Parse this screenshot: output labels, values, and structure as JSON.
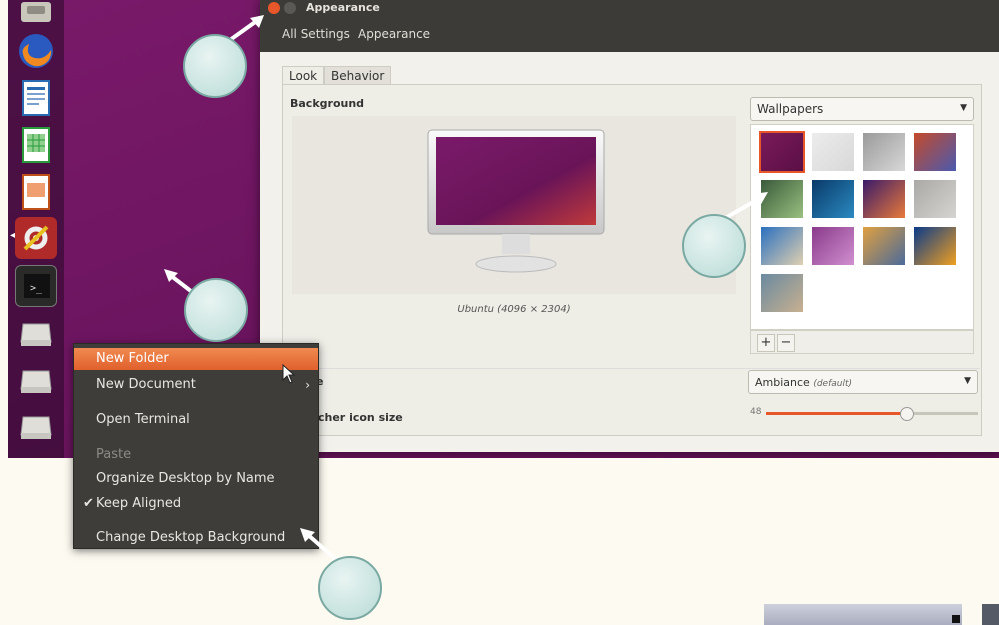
{
  "window": {
    "title": "Appearance",
    "breadcrumbs": [
      "All Settings",
      "Appearance"
    ]
  },
  "tabs": [
    "Look",
    "Behavior"
  ],
  "background": {
    "label": "Background",
    "preview_caption": "Ubuntu (4096 × 2304)",
    "source_select": "Wallpapers",
    "wallpapers": [
      {
        "name": "wallpaper-ubuntu-default",
        "colors": [
          "#7a1a5a",
          "#5a0f45"
        ],
        "selected": true
      },
      {
        "name": "wallpaper-light-grey",
        "colors": [
          "#ececec",
          "#d8d8d8"
        ]
      },
      {
        "name": "wallpaper-grey-stone",
        "colors": [
          "#9a9a9a",
          "#d8d8d8"
        ]
      },
      {
        "name": "wallpaper-red-blue-abstract",
        "colors": [
          "#c44a2a",
          "#4a5ab0"
        ]
      },
      {
        "name": "wallpaper-bird-green",
        "colors": [
          "#3a5a3a",
          "#9ac080"
        ]
      },
      {
        "name": "wallpaper-blue-water",
        "colors": [
          "#0a3a6a",
          "#2a8ac0"
        ]
      },
      {
        "name": "wallpaper-purple-night",
        "colors": [
          "#3a1a6a",
          "#e87a3a"
        ]
      },
      {
        "name": "wallpaper-grey-rocks",
        "colors": [
          "#aaa9a5",
          "#d5d4d0"
        ]
      },
      {
        "name": "wallpaper-beach-sky",
        "colors": [
          "#2a70c0",
          "#e0d0b0"
        ]
      },
      {
        "name": "wallpaper-pink-flowers",
        "colors": [
          "#8a3a8a",
          "#d090d0"
        ]
      },
      {
        "name": "wallpaper-sunset-sea",
        "colors": [
          "#e0a040",
          "#4a6a9a"
        ]
      },
      {
        "name": "wallpaper-blue-orange-glow",
        "colors": [
          "#0a3a8a",
          "#f0a020"
        ]
      },
      {
        "name": "wallpaper-dandelion",
        "colors": [
          "#6a8aa0",
          "#c8b090"
        ]
      }
    ],
    "add_label": "+",
    "remove_label": "−"
  },
  "theme": {
    "label_visible": "e",
    "value": "Ambiance",
    "value_note": "(default)"
  },
  "launcher_icon_size": {
    "label_visible": "cher icon size",
    "value": "48",
    "level": 0.66
  },
  "context_menu": {
    "items": [
      {
        "label": "New Folder",
        "state": "highlighted"
      },
      {
        "label": "New Document",
        "submenu": "›"
      },
      {
        "label": "Open Terminal"
      },
      {
        "label": "Paste",
        "state": "disabled"
      },
      {
        "label": "Organize Desktop by Name"
      },
      {
        "label": "Keep Aligned",
        "check": "✔"
      },
      {
        "label": "Change Desktop Background"
      }
    ]
  },
  "launcher": {
    "items": [
      "files-icon",
      "firefox-icon",
      "writer-icon",
      "calc-icon",
      "impress-icon",
      "system-settings-icon",
      "terminal-icon",
      "drive-icon",
      "drive-icon",
      "drive-icon"
    ]
  },
  "colors": {
    "accent": "#e8572a",
    "desktop": "#6d1560",
    "window_chrome": "#3c3b37"
  }
}
